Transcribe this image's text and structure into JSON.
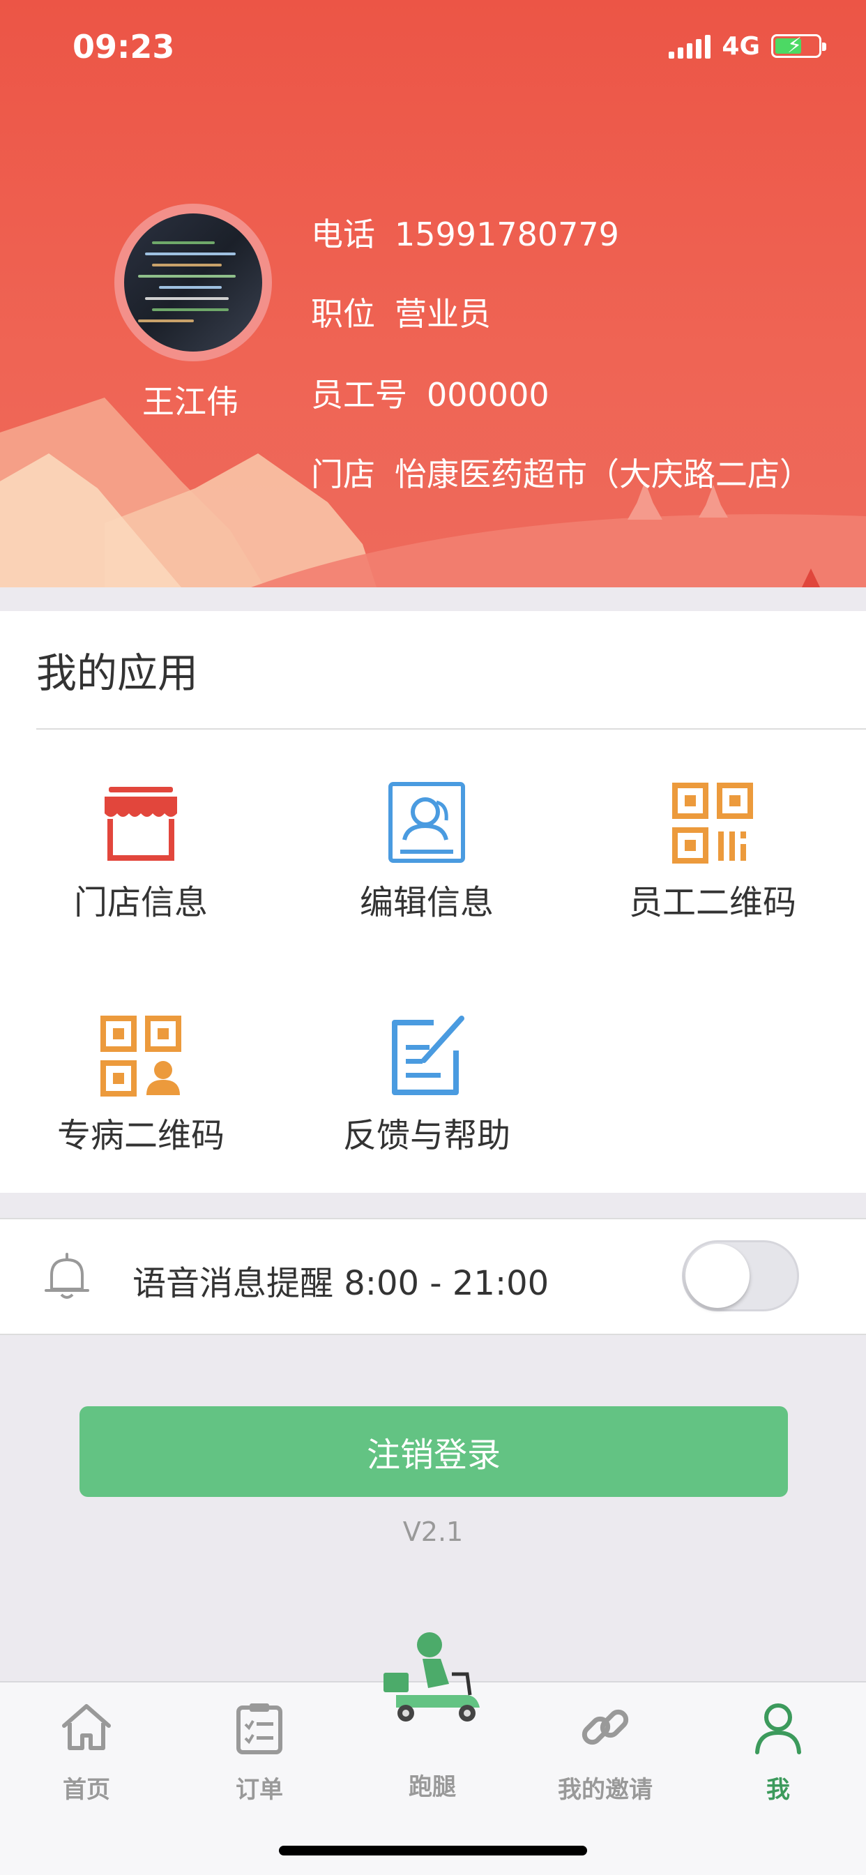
{
  "status_bar": {
    "time": "09:23",
    "network": "4G"
  },
  "profile": {
    "name": "王江伟",
    "phone_label": "电话",
    "phone": "15991780779",
    "position_label": "职位",
    "position": "营业员",
    "employee_id_label": "员工号",
    "employee_id": "000000",
    "store_label": "门店",
    "store": "怡康医药超市（大庆路二店）"
  },
  "apps": {
    "title": "我的应用",
    "items": [
      {
        "label": "门店信息",
        "icon": "storefront-icon",
        "color": "#e2463c"
      },
      {
        "label": "编辑信息",
        "icon": "edit-profile-icon",
        "color": "#4a9be0"
      },
      {
        "label": "员工二维码",
        "icon": "qr-code-icon",
        "color": "#ec9a3c"
      },
      {
        "label": "专病二维码",
        "icon": "qr-code-person-icon",
        "color": "#ec9a3c"
      },
      {
        "label": "反馈与帮助",
        "icon": "feedback-edit-icon",
        "color": "#4a9be0"
      }
    ]
  },
  "voice_reminder": {
    "label": "语音消息提醒 8:00 - 21:00",
    "enabled": false
  },
  "logout": {
    "label": "注销登录"
  },
  "version": "V2.1",
  "tabbar": {
    "items": [
      {
        "label": "首页",
        "icon": "home-icon"
      },
      {
        "label": "订单",
        "icon": "clipboard-icon"
      },
      {
        "label": "跑腿",
        "icon": "delivery-rider-icon"
      },
      {
        "label": "我的邀请",
        "icon": "link-icon"
      },
      {
        "label": "我",
        "icon": "person-icon"
      }
    ],
    "active_index": 4,
    "active_color": "#3c9a5c",
    "inactive_color": "#999999"
  },
  "colors": {
    "header": "#ec5546",
    "primary_button": "#63c383"
  }
}
